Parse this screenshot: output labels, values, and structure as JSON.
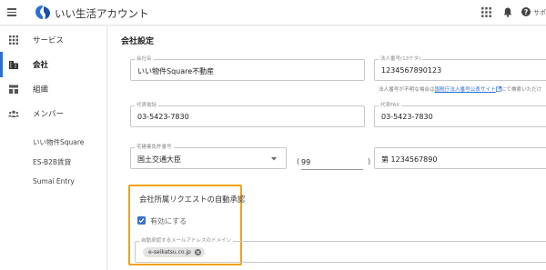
{
  "header": {
    "app_title": "いい生活アカウント",
    "support_label": "サポ"
  },
  "sidebar": {
    "items": [
      {
        "label": "サービス",
        "icon": "grid-icon"
      },
      {
        "label": "会社",
        "icon": "company-icon",
        "active": true
      },
      {
        "label": "組織",
        "icon": "organization-icon"
      },
      {
        "label": "メンバー",
        "icon": "members-icon"
      }
    ],
    "services": [
      "いい物件Square",
      "ES-B2B賃貸",
      "Sumai Entry"
    ]
  },
  "main": {
    "section_title": "会社設定",
    "company_name": {
      "label": "会社名",
      "value": "いい物件Square不動産"
    },
    "corporate_number": {
      "label": "法人番号(13ケタ)",
      "value": "1234567890123"
    },
    "corporate_note": {
      "before": "法人番号が不明な場合は",
      "link": "国税庁法人番号公表サイト",
      "after": "にて検索いただけ"
    },
    "phone": {
      "label": "代表電話",
      "value": "03-5423-7830"
    },
    "fax": {
      "label": "代表FAX",
      "value": "03-5423-7830"
    },
    "license": {
      "label": "宅建業免許番号",
      "authority": "国土交通大臣",
      "renewal": "99",
      "number": "第 1234567890"
    },
    "auto_approval": {
      "title": "会社所属リクエストの自動承認",
      "checkbox_label": "有効にする",
      "checked": true,
      "domain_label": "自動承認するメールアドレスのドメイン",
      "domain_chip": "e-seikatsu.co.jp"
    }
  },
  "colors": {
    "accent": "#2a6fd6",
    "highlight": "#f0a20a",
    "logo": "#2a6fd6"
  }
}
